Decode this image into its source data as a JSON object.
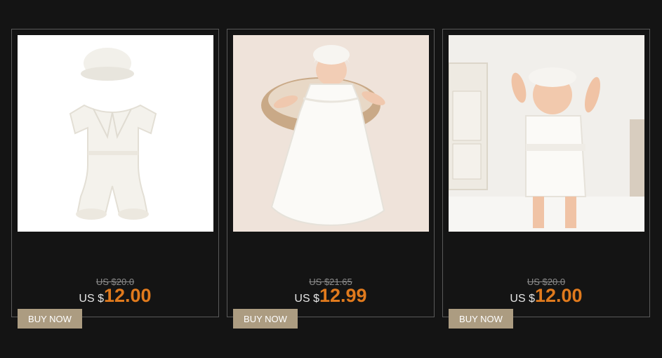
{
  "products": [
    {
      "image_icon": "baby-romper-with-cap-photo",
      "old_price": "US $20.0",
      "currency": "US $",
      "price": "12.00",
      "button_label": "BUY NOW"
    },
    {
      "image_icon": "baby-christening-gown-photo",
      "old_price": "US $21.65",
      "currency": "US $",
      "price": "12.99",
      "button_label": "BUY NOW"
    },
    {
      "image_icon": "baby-boy-romper-outfit-photo",
      "old_price": "US $20.0",
      "currency": "US $",
      "price": "12.00",
      "button_label": "BUY NOW"
    }
  ],
  "colors": {
    "background": "#141414",
    "price_accent": "#e07a1d",
    "button": "#ac9c81",
    "card_border": "#5a5a5a"
  }
}
